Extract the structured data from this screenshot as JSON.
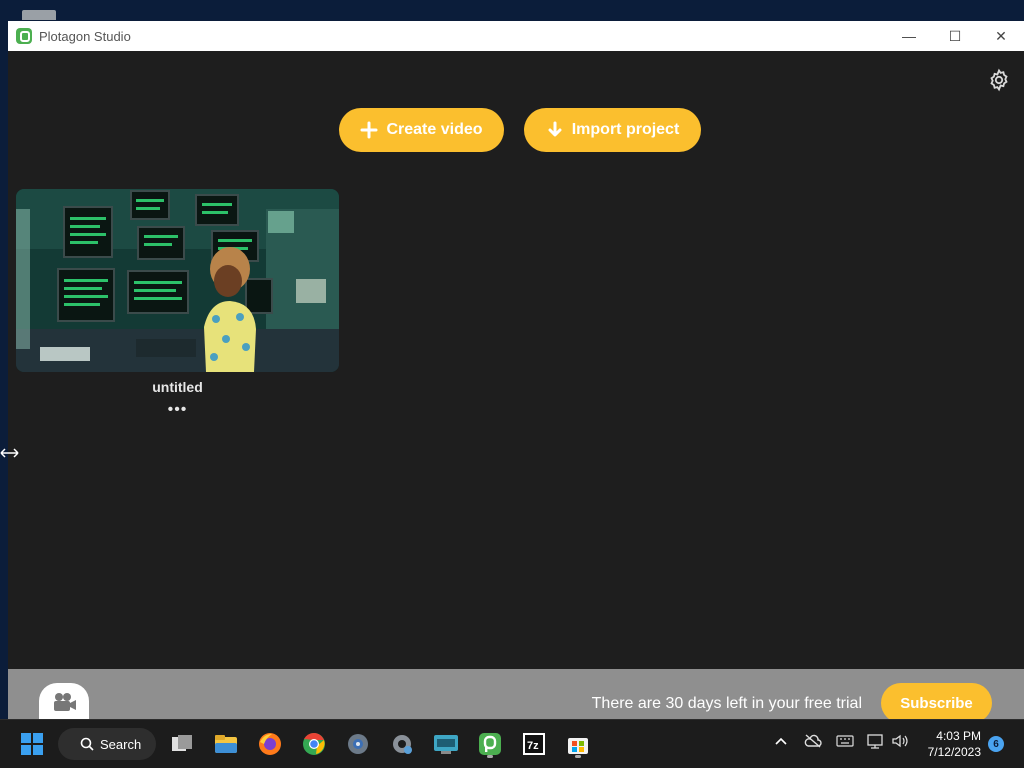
{
  "window": {
    "title": "Plotagon Studio",
    "controls": {
      "minimize": "—",
      "maximize": "☐",
      "close": "✕"
    }
  },
  "actions": {
    "create_label": "Create video",
    "import_label": "Import project"
  },
  "projects": [
    {
      "title": "untitled",
      "more": "•••"
    }
  ],
  "trial": {
    "message": "There are 30 days left in your free trial",
    "subscribe_label": "Subscribe"
  },
  "taskbar": {
    "search_label": "Search",
    "time": "4:03 PM",
    "date": "7/12/2023",
    "notification_count": "6"
  },
  "colors": {
    "accent": "#fbbf2e",
    "app_bg": "#1e1e1e",
    "trial_bar": "#8f8f8f",
    "logo_green": "#4caf50"
  }
}
